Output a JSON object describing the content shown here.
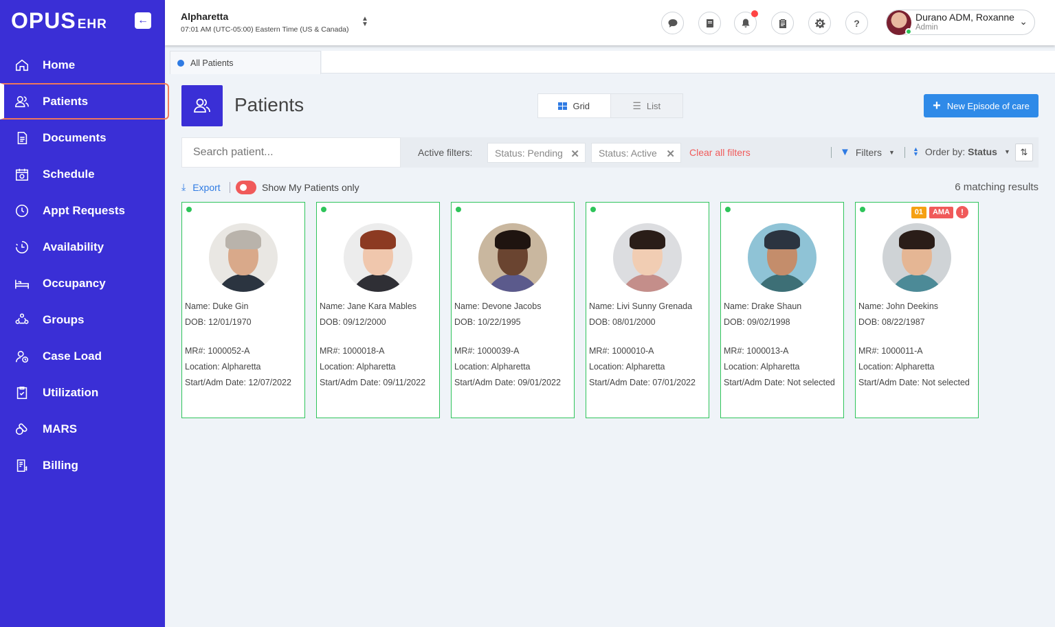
{
  "app": {
    "logo": "OPUS",
    "logo_suffix": "EHR"
  },
  "sidebar": {
    "items": [
      {
        "label": "Home",
        "icon": "home-icon"
      },
      {
        "label": "Patients",
        "icon": "users-icon",
        "active": true
      },
      {
        "label": "Documents",
        "icon": "documents-icon"
      },
      {
        "label": "Schedule",
        "icon": "calendar-icon"
      },
      {
        "label": "Appt Requests",
        "icon": "clock-icon"
      },
      {
        "label": "Availability",
        "icon": "availability-icon"
      },
      {
        "label": "Occupancy",
        "icon": "bed-icon"
      },
      {
        "label": "Groups",
        "icon": "groups-icon"
      },
      {
        "label": "Case Load",
        "icon": "case-load-icon"
      },
      {
        "label": "Utilization",
        "icon": "clipboard-check-icon"
      },
      {
        "label": "MARS",
        "icon": "pills-icon"
      },
      {
        "label": "Billing",
        "icon": "billing-icon"
      }
    ]
  },
  "header": {
    "location_name": "Alpharetta",
    "location_time": "07:01 AM (UTC-05:00) Eastern Time (US & Canada)",
    "icons": [
      "chat-icon",
      "book-icon",
      "bell-icon",
      "clipboard-icon",
      "gear-icon",
      "help-icon"
    ],
    "help_glyph": "?",
    "user_name": "Durano ADM, Roxanne",
    "user_role": "Admin"
  },
  "tabs": [
    {
      "label": "All Patients"
    }
  ],
  "page": {
    "title": "Patients",
    "view_grid_label": "Grid",
    "view_list_label": "List",
    "new_button_label": "New Episode of care"
  },
  "filters": {
    "search_placeholder": "Search patient...",
    "active_label": "Active filters:",
    "chips": [
      "Status: Pending",
      "Status: Active"
    ],
    "clear_label": "Clear all filters",
    "filters_label": "Filters",
    "order_label": "Order by:",
    "order_value": "Status"
  },
  "toolbar": {
    "export_label": "Export",
    "my_patients_label": "Show My Patients only",
    "results_text": "6 matching results"
  },
  "patients": [
    {
      "name": "Name: Duke Gin",
      "dob": "DOB: 12/01/1970",
      "mr": "MR#: 1000052-A",
      "location": "Location: Alpharetta",
      "start": "Start/Adm Date: 12/07/2022",
      "skin": "#d9a98a",
      "hair": "#b9b3ab",
      "shirt": "#2b3440",
      "bg": "#e9e7e3"
    },
    {
      "name": "Name: Jane Kara Mables",
      "dob": "DOB: 09/12/2000",
      "mr": "MR#: 1000018-A",
      "location": "Location: Alpharetta",
      "start": "Start/Adm Date: 09/11/2022",
      "skin": "#f0c7ad",
      "hair": "#8c3a22",
      "shirt": "#2f2f35",
      "bg": "#ececec"
    },
    {
      "name": "Name: Devone Jacobs",
      "dob": "DOB: 10/22/1995",
      "mr": "MR#: 1000039-A",
      "location": "Location: Alpharetta",
      "start": "Start/Adm Date: 09/01/2022",
      "skin": "#6a4430",
      "hair": "#1f1410",
      "shirt": "#5b5a8c",
      "bg": "#c9b79f"
    },
    {
      "name": "Name: Livi Sunny Grenada",
      "dob": "DOB: 08/01/2000",
      "mr": "MR#: 1000010-A",
      "location": "Location: Alpharetta",
      "start": "Start/Adm Date: 07/01/2022",
      "skin": "#f1cdb3",
      "hair": "#2a1d18",
      "shirt": "#c48e8a",
      "bg": "#dcdde0"
    },
    {
      "name": "Name: Drake Shaun",
      "dob": "DOB: 09/02/1998",
      "mr": "MR#: 1000013-A",
      "location": "Location: Alpharetta",
      "start": "Start/Adm Date: Not selected",
      "skin": "#c48d6b",
      "hair": "#2b3440",
      "shirt": "#3d6f76",
      "bg": "#8fc3d6"
    },
    {
      "name": "Name: John Deekins",
      "dob": "DOB: 08/22/1987",
      "mr": "MR#: 1000011-A",
      "location": "Location: Alpharetta",
      "start": "Start/Adm Date: Not selected",
      "skin": "#e5b694",
      "hair": "#2a1d18",
      "shirt": "#4c8a97",
      "bg": "#cfd3d6",
      "badge_number": "01",
      "badge_text": "AMA",
      "badge_alert": "!"
    }
  ]
}
